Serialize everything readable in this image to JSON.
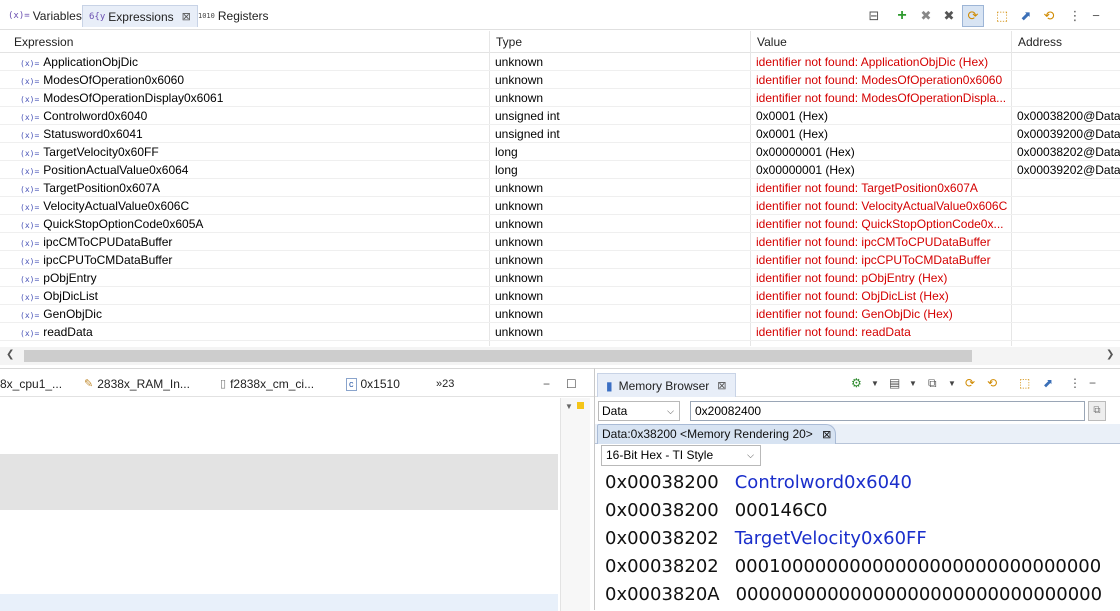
{
  "top_tabs": {
    "variables": {
      "icon": "(x)=",
      "label": "Variables"
    },
    "expressions": {
      "icon": "6{y",
      "label": "Expressions"
    },
    "registers": {
      "icon": "1010",
      "label": "Registers"
    }
  },
  "columns": {
    "expression": "Expression",
    "type": "Type",
    "value": "Value",
    "address": "Address"
  },
  "rows": [
    {
      "expr": "ApplicationObjDic",
      "type": "unknown",
      "value": "identifier not found: ApplicationObjDic (Hex)",
      "address": "",
      "error": true
    },
    {
      "expr": "ModesOfOperation0x6060",
      "type": "unknown",
      "value": "identifier not found: ModesOfOperation0x6060",
      "address": "",
      "error": true
    },
    {
      "expr": "ModesOfOperationDisplay0x6061",
      "type": "unknown",
      "value": "identifier not found: ModesOfOperationDispla...",
      "address": "",
      "error": true
    },
    {
      "expr": "Controlword0x6040",
      "type": "unsigned int",
      "value": "0x0001 (Hex)",
      "address": "0x00038200@Data",
      "error": false
    },
    {
      "expr": "Statusword0x6041",
      "type": "unsigned int",
      "value": "0x0001 (Hex)",
      "address": "0x00039200@Data",
      "error": false
    },
    {
      "expr": "TargetVelocity0x60FF",
      "type": "long",
      "value": "0x00000001 (Hex)",
      "address": "0x00038202@Data",
      "error": false
    },
    {
      "expr": "PositionActualValue0x6064",
      "type": "long",
      "value": "0x00000001 (Hex)",
      "address": "0x00039202@Data",
      "error": false
    },
    {
      "expr": "TargetPosition0x607A",
      "type": "unknown",
      "value": "identifier not found: TargetPosition0x607A",
      "address": "",
      "error": true
    },
    {
      "expr": "VelocityActualValue0x606C",
      "type": "unknown",
      "value": "identifier not found: VelocityActualValue0x606C",
      "address": "",
      "error": true
    },
    {
      "expr": "QuickStopOptionCode0x605A",
      "type": "unknown",
      "value": "identifier not found: QuickStopOptionCode0x...",
      "address": "",
      "error": true
    },
    {
      "expr": "ipcCMToCPUDataBuffer",
      "type": "unknown",
      "value": "identifier not found: ipcCMToCPUDataBuffer",
      "address": "",
      "error": true
    },
    {
      "expr": "ipcCPUToCMDataBuffer",
      "type": "unknown",
      "value": "identifier not found: ipcCPUToCMDataBuffer",
      "address": "",
      "error": true
    },
    {
      "expr": "pObjEntry",
      "type": "unknown",
      "value": "identifier not found: pObjEntry (Hex)",
      "address": "",
      "error": true
    },
    {
      "expr": "ObjDicList",
      "type": "unknown",
      "value": "identifier not found: ObjDicList (Hex)",
      "address": "",
      "error": true
    },
    {
      "expr": "GenObjDic",
      "type": "unknown",
      "value": "identifier not found: GenObjDic (Hex)",
      "address": "",
      "error": true
    },
    {
      "expr": "readData",
      "type": "unknown",
      "value": "identifier not found: readData",
      "address": "",
      "error": true
    }
  ],
  "left_tabs": [
    "8x_cpu1_...",
    "2838x_RAM_In...",
    "f2838x_cm_ci...",
    "0x1510",
    "»23"
  ],
  "memory": {
    "tab_label": "Memory Browser",
    "space_value": "Data",
    "address_value": "0x20082400",
    "rendering_tab": "Data:0x38200 <Memory Rendering 20>",
    "format_value": "16-Bit Hex - TI Style",
    "lines": [
      {
        "address": "0x00038200",
        "label": "Controlword0x6040",
        "data": ""
      },
      {
        "address": "0x00038200",
        "label": "",
        "data": "000146C0"
      },
      {
        "address": "0x00038202",
        "label": "TargetVelocity0x60FF",
        "data": ""
      },
      {
        "address": "0x00038202",
        "label": "",
        "data": "00010000000000000000000000000000"
      },
      {
        "address": "0x0003820A",
        "label": "",
        "data": "00000000000000000000000000000000"
      }
    ]
  },
  "colors": {
    "error": "#d40000",
    "label_blue": "#1a2ecb",
    "active_tab": "#e8eef8"
  }
}
